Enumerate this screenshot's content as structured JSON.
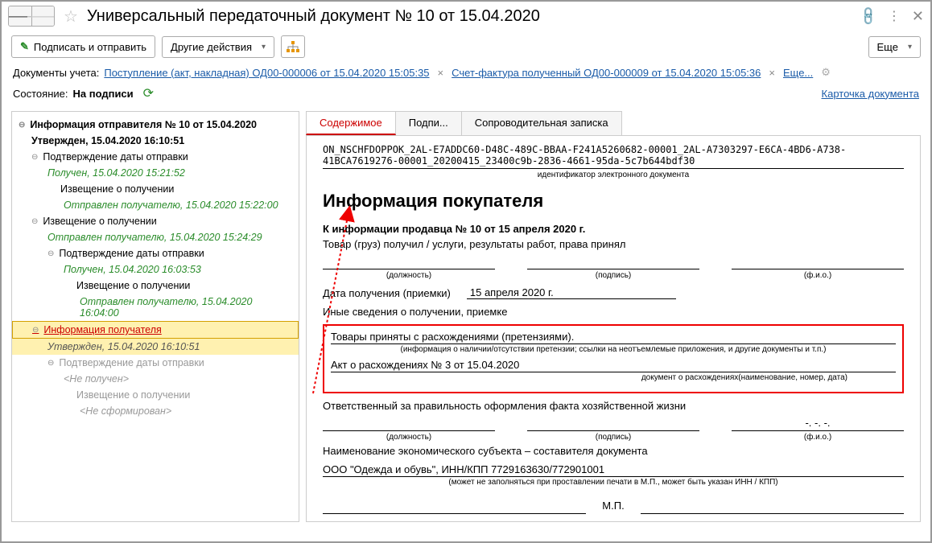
{
  "title": "Универсальный передаточный документ № 10 от 15.04.2020",
  "toolbar": {
    "sign_send": "Подписать и отправить",
    "other_actions": "Другие действия",
    "more": "Еще"
  },
  "docrow": {
    "label": "Документы учета:",
    "link1": "Поступление (акт, накладная) ОД00-000006 от 15.04.2020 15:05:35",
    "link2": "Счет-фактура полученный ОД00-000009 от 15.04.2020 15:05:36",
    "more": "Еще..."
  },
  "status": {
    "label": "Состояние:",
    "value": "На подписи",
    "card": "Карточка документа"
  },
  "tree": {
    "root": "Информация отправителя № 10 от 15.04.2020",
    "root_status": "Утвержден, 15.04.2020 16:10:51",
    "n1": "Подтверждение даты отправки",
    "n1s": "Получен, 15.04.2020 15:21:52",
    "n2": "Извещение о получении",
    "n2s": "Отправлен получателю, 15.04.2020 15:22:00",
    "n3": "Извещение о получении",
    "n3s": "Отправлен получателю, 15.04.2020 15:24:29",
    "n4": "Подтверждение даты отправки",
    "n4s": "Получен, 15.04.2020 16:03:53",
    "n5": "Извещение о получении",
    "n5s": "Отправлен получателю, 15.04.2020 16:04:00",
    "n6": "Информация получателя",
    "n6s": "Утвержден, 15.04.2020 16:10:51",
    "n7": "Подтверждение даты отправки",
    "n7s": "<Не получен>",
    "n8": "Извещение о получении",
    "n8s": "<Не сформирован>"
  },
  "tabs": {
    "t1": "Содержимое",
    "t2": "Подпи...",
    "t3": "Сопроводительная записка"
  },
  "doc": {
    "id": "ON_NSCHFDOPPOK_2AL-E7ADDC60-D48C-489C-BBAA-F241A5260682-00001_2AL-A7303297-E6CA-4BD6-A738-41BCA7619276-00001_20200415_23400c9b-2836-4661-95da-5c7b644bdf30",
    "id_label": "идентификатор электронного документа",
    "h1": "Информация покупателя",
    "seller_ref": "К информации продавца № 10 от 15 апреля 2020 г.",
    "received": "Товар (груз) получил / услуги, результаты работ, права принял",
    "sig_pos": "(должность)",
    "sig_sign": "(подпись)",
    "sig_fio": "(ф.и.о.)",
    "date_recv_label": "Дата получения (приемки)",
    "date_recv_value": "15 апреля 2020 г.",
    "other_info": "Иные сведения о получении, приемке",
    "claim_text": "Товары приняты с расхождениями (претензиями).",
    "claim_sub": "(информация о наличии/отсутствии претензии; ссылки на неотъемлемые приложения, и другие  документы и т.п.)",
    "act_text": "Акт о расхождениях № 3 от 15.04.2020",
    "act_sub": "документ о расхождениях(наименование, номер, дата)",
    "responsible": "Ответственный за правильность оформления факта хозяйственной жизни",
    "dash_fio": "-. -. -.",
    "subject_label": "Наименование экономического субъекта – составителя документа",
    "subject_value": "ООО \"Одежда и обувь\", ИНН/КПП 7729163630/772901001",
    "subject_sub": "(может не заполняться при проставлении печати в М.П., может быть указан ИНН / КПП)",
    "mp": "М.П."
  }
}
